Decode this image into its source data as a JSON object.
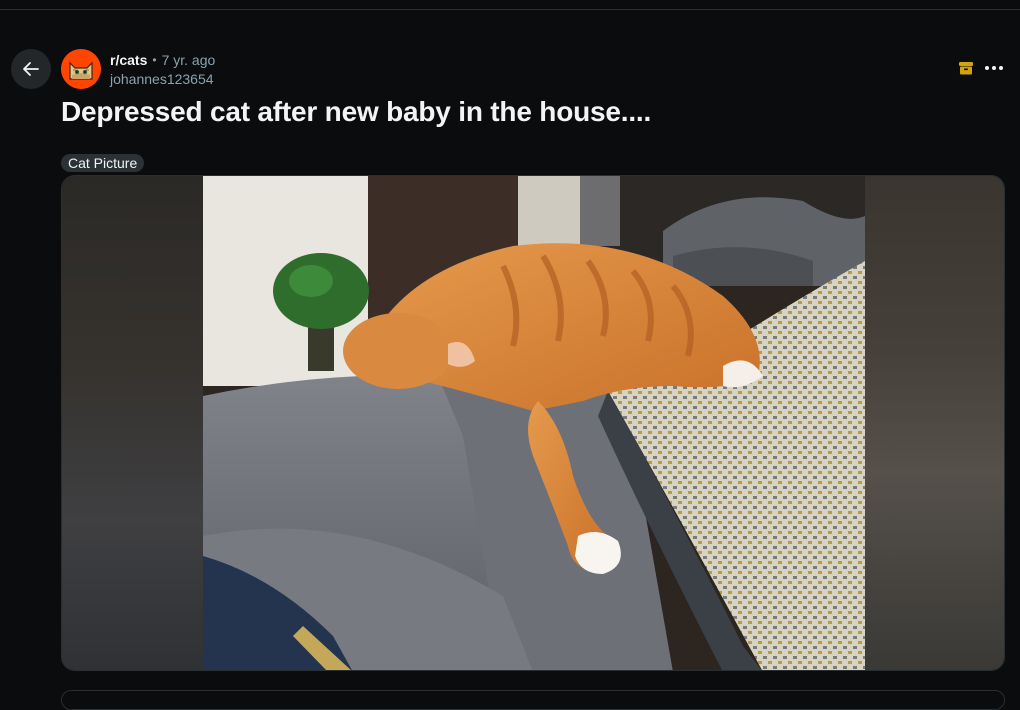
{
  "post": {
    "subreddit": "r/cats",
    "separator": "•",
    "age": "7 yr. ago",
    "author": "johannes123654",
    "title": "Depressed cat after new baby in the house....",
    "flair": "Cat Picture"
  },
  "icons": {
    "back": "arrow-left-icon",
    "archive": "archive-icon",
    "more": "ellipsis-icon",
    "avatar": "cat-avatar-icon"
  },
  "colors": {
    "background": "#0b0c0e",
    "text": "#f2f4f5",
    "muted_text": "#8ba2ad",
    "avatar_bg": "#ff4500",
    "archive": "#d4a10f",
    "flair_bg": "#2a3236"
  }
}
